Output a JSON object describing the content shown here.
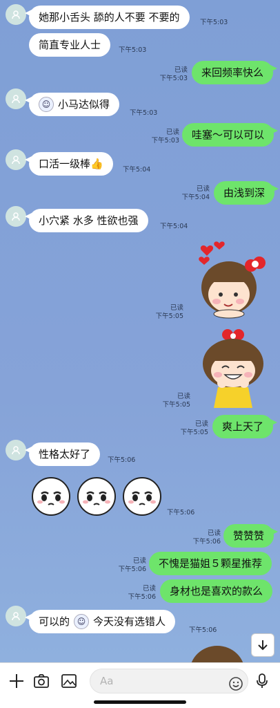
{
  "messages": [
    {
      "side": "in",
      "text": "她那小舌头 舔的人不要 不要的",
      "time": "下午5:03"
    },
    {
      "side": "in",
      "text": "简直专业人士",
      "time": "下午5:03"
    },
    {
      "side": "out",
      "text": "来回频率快么",
      "read": "已读",
      "time": "下午5:03"
    },
    {
      "side": "in",
      "text": "小马达似得",
      "time": "下午5:03"
    },
    {
      "side": "out",
      "text": "哇塞～可以可以",
      "read": "已读",
      "time": "下午5:03"
    },
    {
      "side": "in",
      "text": "口活一级棒👍",
      "time": "下午5:04"
    },
    {
      "side": "out",
      "text": "由浅到深",
      "read": "已读",
      "time": "下午5:04"
    },
    {
      "side": "in",
      "text": "小穴紧 水多 性欲也强",
      "time": "下午5:04"
    },
    {
      "side": "out",
      "sticker": "girl-hearts-sticker",
      "read": "已读",
      "time": "下午5:05"
    },
    {
      "side": "out",
      "sticker": "girl-laughing-sticker",
      "read": "已读",
      "time": "下午5:05"
    },
    {
      "side": "out",
      "text": "爽上天了",
      "read": "已读",
      "time": "下午5:05"
    },
    {
      "side": "in",
      "text": "性格太好了",
      "time": "下午5:06"
    },
    {
      "side": "in",
      "sticker": "crying-faces-sticker",
      "time": "下午5:06"
    },
    {
      "side": "out",
      "text": "赞赞赞",
      "read": "已读",
      "time": "下午5:06"
    },
    {
      "side": "out",
      "text": "不愧是猫姐５颗星推荐",
      "read": "已读",
      "time": "下午5:06"
    },
    {
      "side": "out",
      "text": "身材也是喜欢的款么",
      "read": "已读",
      "time": "下午5:06"
    },
    {
      "side": "in",
      "text_a": "可以的",
      "text_b": "今天没有选错人",
      "time": "下午5:06"
    }
  ],
  "input": {
    "placeholder": "Aa"
  },
  "icons": [
    "plus-icon",
    "camera-icon",
    "image-icon",
    "smiley-icon",
    "microphone-icon",
    "scroll-down-icon"
  ],
  "colors": {
    "chat_bg": "#85a3d8",
    "out_bubble": "#6ee46b",
    "in_bubble": "#ffffff"
  }
}
